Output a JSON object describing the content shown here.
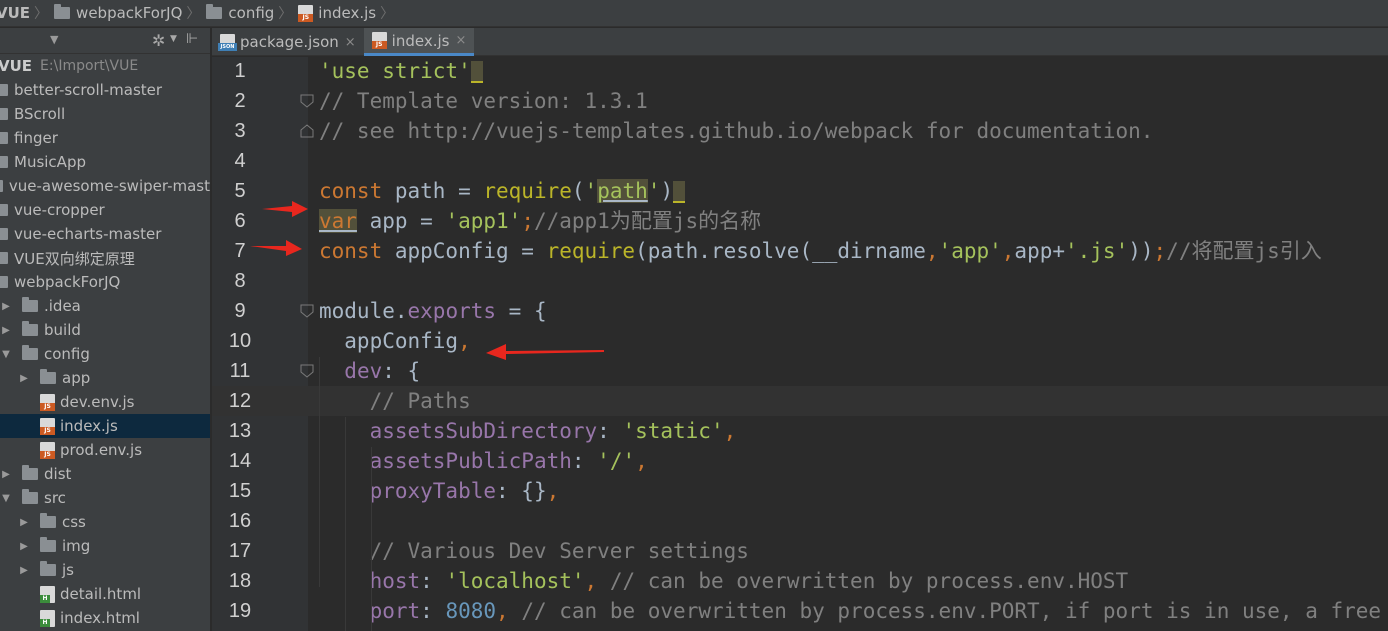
{
  "breadcrumb": {
    "items": [
      {
        "label": "VUE",
        "icon": "folder-icon"
      },
      {
        "label": "webpackForJQ",
        "icon": "folder-icon"
      },
      {
        "label": "config",
        "icon": "folder-icon"
      },
      {
        "label": "index.js",
        "icon": "js-file-icon"
      }
    ]
  },
  "sidebar": {
    "root": {
      "label": "VUE",
      "path": "E:\\Import\\VUE"
    },
    "items": [
      {
        "label": "better-scroll-master",
        "depth": 0,
        "type": "folder"
      },
      {
        "label": "BScroll",
        "depth": 0,
        "type": "folder"
      },
      {
        "label": "finger",
        "depth": 0,
        "type": "folder"
      },
      {
        "label": "MusicApp",
        "depth": 0,
        "type": "folder"
      },
      {
        "label": "vue-awesome-swiper-mast",
        "depth": 0,
        "type": "folder"
      },
      {
        "label": "vue-cropper",
        "depth": 0,
        "type": "folder"
      },
      {
        "label": "vue-echarts-master",
        "depth": 0,
        "type": "folder"
      },
      {
        "label": "VUE双向绑定原理",
        "depth": 0,
        "type": "folder"
      },
      {
        "label": "webpackForJQ",
        "depth": 0,
        "type": "folder"
      },
      {
        "label": ".idea",
        "depth": 1,
        "type": "folder",
        "arrow": "▶"
      },
      {
        "label": "build",
        "depth": 1,
        "type": "folder",
        "arrow": "▶"
      },
      {
        "label": "config",
        "depth": 1,
        "type": "folder",
        "arrow": "▼"
      },
      {
        "label": "app",
        "depth": 2,
        "type": "folder",
        "arrow": "▶"
      },
      {
        "label": "dev.env.js",
        "depth": 2,
        "type": "js"
      },
      {
        "label": "index.js",
        "depth": 2,
        "type": "js",
        "selected": true
      },
      {
        "label": "prod.env.js",
        "depth": 2,
        "type": "js"
      },
      {
        "label": "dist",
        "depth": 1,
        "type": "folder",
        "arrow": "▶"
      },
      {
        "label": "src",
        "depth": 1,
        "type": "folder",
        "arrow": "▼"
      },
      {
        "label": "css",
        "depth": 2,
        "type": "folder",
        "arrow": "▶"
      },
      {
        "label": "img",
        "depth": 2,
        "type": "folder",
        "arrow": "▶"
      },
      {
        "label": "js",
        "depth": 2,
        "type": "folder",
        "arrow": "▶"
      },
      {
        "label": "detail.html",
        "depth": 2,
        "type": "html"
      },
      {
        "label": "index.html",
        "depth": 2,
        "type": "html"
      }
    ]
  },
  "tabs": [
    {
      "label": "package.json",
      "icon": "json-file-icon",
      "active": false,
      "close": "×"
    },
    {
      "label": "index.js",
      "icon": "js-file-icon",
      "active": true,
      "close": "×"
    }
  ],
  "editor": {
    "current_line": 12,
    "lines": [
      {
        "n": "1",
        "fold": "",
        "tokens": [
          [
            "str",
            "'use strict'"
          ],
          [
            "cursor",
            ""
          ]
        ]
      },
      {
        "n": "2",
        "fold": "start",
        "tokens": [
          [
            "cmt",
            "// Template version: 1.3.1"
          ]
        ]
      },
      {
        "n": "3",
        "fold": "end",
        "tokens": [
          [
            "cmt",
            "// see http://vuejs-templates.github.io/webpack for documentation."
          ]
        ]
      },
      {
        "n": "4",
        "fold": "",
        "tokens": []
      },
      {
        "n": "5",
        "fold": "",
        "tokens": [
          [
            "kw",
            "const "
          ],
          [
            "plain",
            "path = "
          ],
          [
            "fn",
            "require"
          ],
          [
            "plain",
            "("
          ],
          [
            "str",
            "'"
          ],
          [
            "strwarn",
            "path"
          ],
          [
            "str",
            "'"
          ],
          [
            "plain",
            ")"
          ],
          [
            "cursor",
            ""
          ]
        ]
      },
      {
        "n": "6",
        "fold": "",
        "tokens": [
          [
            "kwwarn",
            "var"
          ],
          [
            "plain",
            " app = "
          ],
          [
            "str",
            "'app1'"
          ],
          [
            "kw",
            ";"
          ],
          [
            "cmt",
            "//app1"
          ],
          [
            "cmtcn",
            "为配置"
          ],
          [
            "cmt",
            "js"
          ],
          [
            "cmtcn",
            "的名称"
          ]
        ]
      },
      {
        "n": "7",
        "fold": "",
        "tokens": [
          [
            "kw",
            "const "
          ],
          [
            "plain",
            "appConfig = "
          ],
          [
            "fn",
            "require"
          ],
          [
            "plain",
            "(path.resolve(__dirname"
          ],
          [
            "kw",
            ","
          ],
          [
            "str",
            "'app'"
          ],
          [
            "kw",
            ","
          ],
          [
            "plain",
            "app+"
          ],
          [
            "str",
            "'.js'"
          ],
          [
            "plain",
            "))"
          ],
          [
            "kw",
            ";"
          ],
          [
            "cmt",
            "//"
          ],
          [
            "cmtcn",
            "将配置"
          ],
          [
            "cmt",
            "js"
          ],
          [
            "cmtcn",
            "引入"
          ]
        ]
      },
      {
        "n": "8",
        "fold": "",
        "tokens": []
      },
      {
        "n": "9",
        "fold": "start",
        "tokens": [
          [
            "plain",
            "module."
          ],
          [
            "prop",
            "exports"
          ],
          [
            "plain",
            " = {"
          ]
        ]
      },
      {
        "n": "10",
        "fold": "",
        "tokens": [
          [
            "plain",
            "  appConfig"
          ],
          [
            "kw",
            ","
          ]
        ]
      },
      {
        "n": "11",
        "fold": "start",
        "tokens": [
          [
            "plain",
            "  "
          ],
          [
            "prop",
            "dev"
          ],
          [
            "plain",
            ": {"
          ]
        ]
      },
      {
        "n": "12",
        "fold": "",
        "tokens": [
          [
            "cmt",
            "    // Paths"
          ]
        ]
      },
      {
        "n": "13",
        "fold": "",
        "tokens": [
          [
            "plain",
            "    "
          ],
          [
            "prop",
            "assetsSubDirectory"
          ],
          [
            "plain",
            ": "
          ],
          [
            "str",
            "'static'"
          ],
          [
            "kw",
            ","
          ]
        ]
      },
      {
        "n": "14",
        "fold": "",
        "tokens": [
          [
            "plain",
            "    "
          ],
          [
            "prop",
            "assetsPublicPath"
          ],
          [
            "plain",
            ": "
          ],
          [
            "str",
            "'/'"
          ],
          [
            "kw",
            ","
          ]
        ]
      },
      {
        "n": "15",
        "fold": "",
        "tokens": [
          [
            "plain",
            "    "
          ],
          [
            "prop",
            "proxyTable"
          ],
          [
            "plain",
            ": {}"
          ],
          [
            "kw",
            ","
          ]
        ]
      },
      {
        "n": "16",
        "fold": "",
        "tokens": []
      },
      {
        "n": "17",
        "fold": "",
        "tokens": [
          [
            "cmt",
            "    // Various Dev Server settings"
          ]
        ]
      },
      {
        "n": "18",
        "fold": "",
        "tokens": [
          [
            "plain",
            "    "
          ],
          [
            "prop",
            "host"
          ],
          [
            "plain",
            ": "
          ],
          [
            "str",
            "'localhost'"
          ],
          [
            "kw",
            ", "
          ],
          [
            "cmt",
            "// can be overwritten by process.env.HOST"
          ]
        ]
      },
      {
        "n": "19",
        "fold": "",
        "tokens": [
          [
            "plain",
            "    "
          ],
          [
            "prop",
            "port"
          ],
          [
            "plain",
            ": "
          ],
          [
            "num",
            "8080"
          ],
          [
            "kw",
            ", "
          ],
          [
            "cmt",
            "// can be overwritten by process.env.PORT, if port is in use, a free"
          ]
        ]
      }
    ]
  },
  "colors": {
    "keyword": "#cc7832",
    "string": "#6a8759",
    "comment": "#808080",
    "property": "#9876aa",
    "number": "#6897bb",
    "annotation_arrow": "#e8271e"
  }
}
